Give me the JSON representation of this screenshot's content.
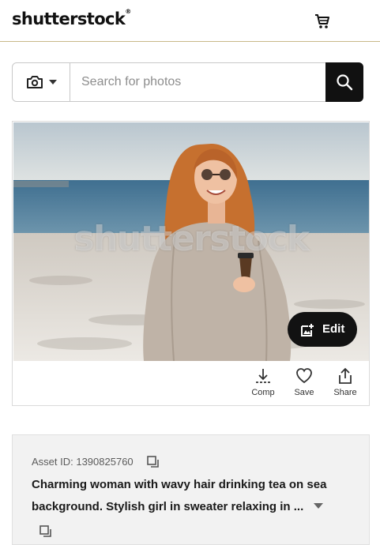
{
  "header": {
    "logo_text": "shutterstock",
    "logo_mark": "®",
    "cart_icon": "shopping-cart-icon"
  },
  "search": {
    "camera_icon": "camera-icon",
    "dropdown_icon": "caret-down-icon",
    "placeholder": "Search for photos",
    "value": "",
    "submit_icon": "search-icon"
  },
  "image": {
    "watermark": "shutterstock",
    "edit_label": "Edit",
    "actions": [
      {
        "label": "Comp",
        "icon": "download-icon"
      },
      {
        "label": "Save",
        "icon": "heart-icon"
      },
      {
        "label": "Share",
        "icon": "share-icon"
      }
    ]
  },
  "asset": {
    "id_text": "Asset ID: 1390825760",
    "description": "Charming woman with wavy hair drinking tea on sea background. Stylish girl in sweater relaxing in ..."
  },
  "colors": {
    "header_border": "#c9b98a",
    "button_dark": "#121212",
    "info_bg": "#f2f2f2"
  }
}
